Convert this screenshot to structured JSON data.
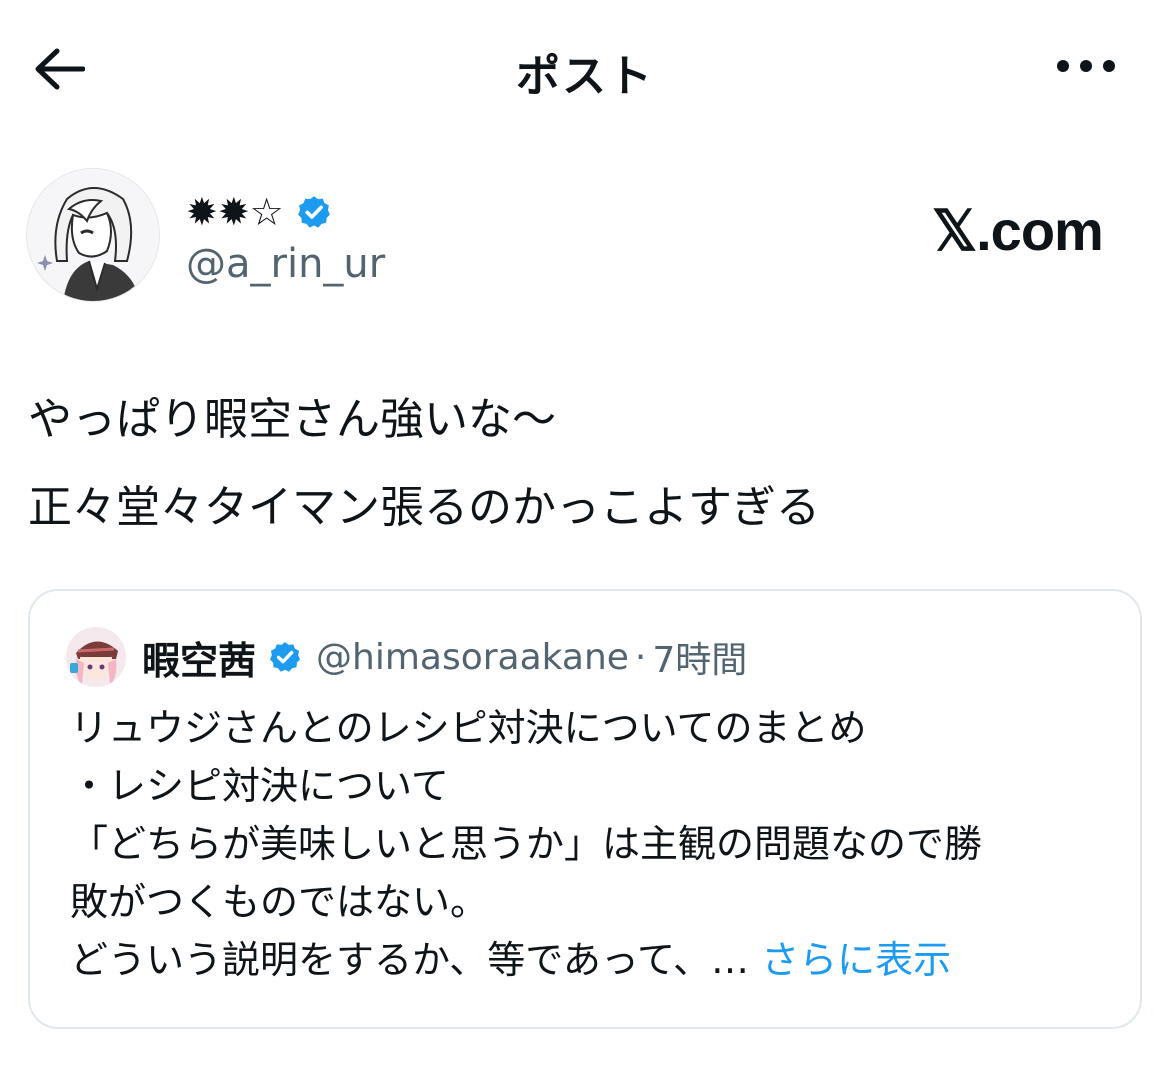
{
  "header": {
    "title": "ポスト",
    "back_icon": "arrow-left-icon",
    "more_icon": "more-horizontal-icon"
  },
  "author": {
    "display_name": "✹✹☆",
    "handle": "@a_rin_ur",
    "verified_icon": "verified-badge-icon",
    "watermark": "𝕏.com"
  },
  "post": {
    "lines": [
      "やっぱり暇空さん強いな〜",
      "正々堂々タイマン張るのかっこよすぎる"
    ]
  },
  "quote": {
    "name": "暇空茜",
    "handle": "@himasoraakane",
    "separator": "·",
    "time": "7時間",
    "lines": [
      "リュウジさんとのレシピ対決についてのまとめ",
      "・レシピ対決について",
      "「どちらが美味しいと思うか」は主観の問題なので勝",
      "敗がつくものではない。"
    ],
    "last_line": "どういう説明をするか、等であって、… ",
    "show_more": "さらに表示"
  },
  "colors": {
    "text": "#0f1419",
    "secondary": "#536471",
    "accent": "#1d9bf0",
    "border": "#e1e8ed"
  }
}
